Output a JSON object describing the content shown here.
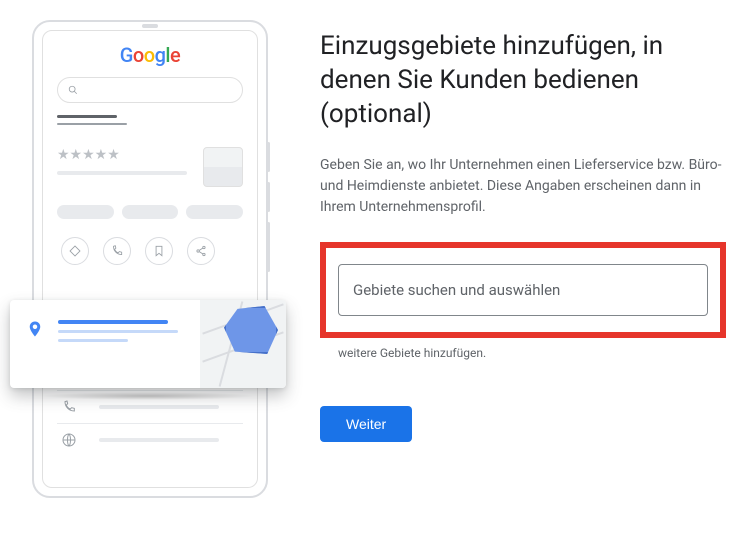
{
  "illustration": {
    "logo_letters": [
      "G",
      "o",
      "o",
      "g",
      "l",
      "e"
    ]
  },
  "main": {
    "heading": "Einzugsgebiete hinzufügen, in denen Sie Kunden bedienen (optional)",
    "description": "Geben Sie an, wo Ihr Unternehmen einen Lieferservice bzw. Büro- und Heimdienste anbietet. Diese Angaben erscheinen dann in Ihrem Unternehmensprofil.",
    "search_placeholder": "Gebiete suchen und auswählen",
    "note": "weitere Gebiete hinzufügen.",
    "button": "Weiter"
  }
}
